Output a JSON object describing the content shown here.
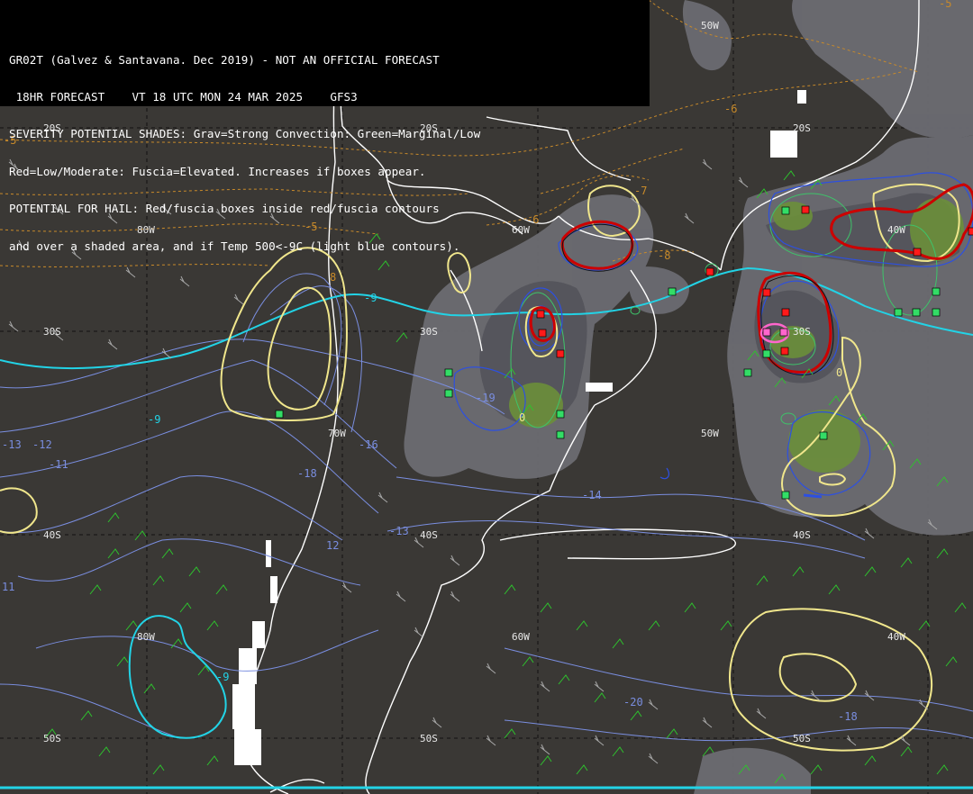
{
  "header": {
    "line1": "GR02T (Galvez & Santavana. Dec 2019) - NOT AN OFFICIAL FORECAST",
    "line2": " 18HR FORECAST    VT 18 UTC MON 24 MAR 2025    GFS3",
    "line3": "SEVERITY POTENTIAL SHADES: Grav=Strong Convection: Green=Marginal/Low",
    "line4": "Red=Low/Moderate: Fuscia=Elevated. Increases if boxes appear.",
    "line5": "POTENTIAL FOR HAIL: Red/fuscia boxes inside red/fuscia contours",
    "line6": "and over a shaded area, and if Temp 500<-9C (light blue contours)."
  },
  "grid_labels": {
    "lon_50w_top": "50W",
    "lat_20s_a": "20S",
    "lat_20s_b": "20S",
    "lat_20s_c": "20S",
    "lon_80w_a": "80W",
    "lon_60w_a": "60W",
    "lon_40w_a": "40W",
    "lat_30s_a": "30S",
    "lat_30s_b": "30S",
    "lat_30s_c": "30S",
    "lon_70w": "70W",
    "lon_50w_mid": "50W",
    "lat_40s_a": "40S",
    "lat_40s_b": "40S",
    "lat_40s_c": "40S",
    "lon_80w_b": "80W",
    "lon_60w_b": "60W",
    "lon_40w_b": "40W",
    "lat_50s_a": "50S",
    "lat_50s_b": "50S",
    "lat_50s_c": "50S"
  },
  "contour_labels": {
    "t_m5_top": "-5",
    "t_m5_left": "-5",
    "t_m6": "-6",
    "t_m5_mid": "-5",
    "t_m6_mid": "-6",
    "t_m7": "-7",
    "t_m8": "-8",
    "c_m9_a": "-9",
    "c_m9_b": "-9",
    "c_m9_c": "-9",
    "c_m13": "-13",
    "c_m12": "-12",
    "c_m11": "-11",
    "c_m16": "-16",
    "c_m18": "-18",
    "c_m14": "-14",
    "c_m13b": "-13",
    "c_m12b": "12",
    "c_m11b": "11",
    "c_m19": "-19",
    "c_m20": "-20",
    "c_m18b": "-18",
    "y_0a": "0",
    "y_0b": "0",
    "y_8": "8"
  },
  "colors": {
    "background": "#3a3835",
    "coast": "#ffffff",
    "shade_gray": "#6e6e74",
    "shade_gray_dark": "#55555b",
    "shade_green": "#6b8f3a",
    "yellow": "#f0e68c",
    "red": "#cc0000",
    "cyan": "#22d3e6",
    "blue": "#2d50e0",
    "light_blue": "#7a8ee0",
    "orange": "#c88a2a",
    "green_barb": "#2ec22e",
    "gray_barb": "#a0a0a0",
    "box_red": "#ff1a1a",
    "box_green": "#33dd66",
    "box_fuscia": "#ff66cc"
  },
  "legend_meaning": {
    "gray": "Strong Convection",
    "green": "Marginal/Low",
    "red": "Low/Moderate",
    "fuscia": "Elevated"
  }
}
